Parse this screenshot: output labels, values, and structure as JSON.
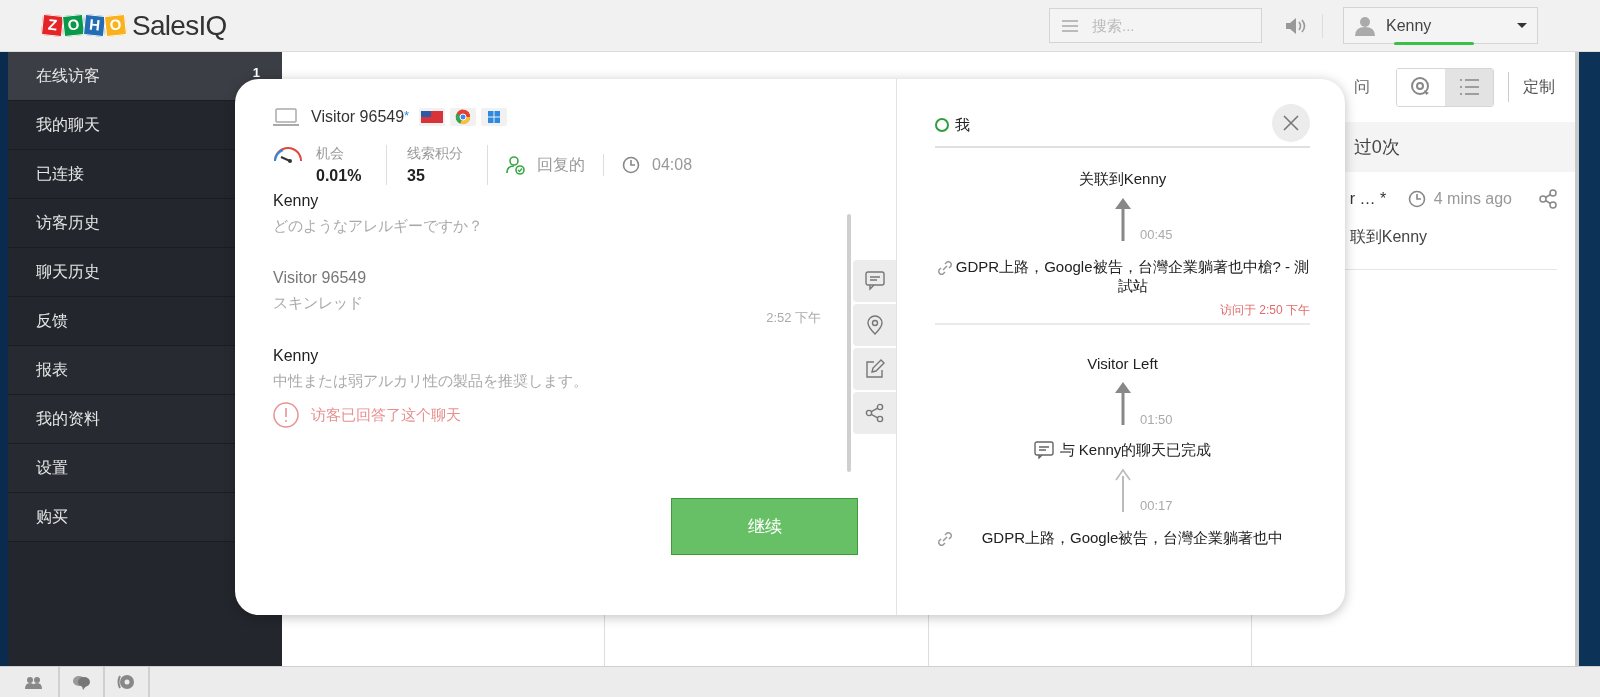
{
  "header": {
    "logo_letters": [
      {
        "letter": "Z",
        "color": "#e42527"
      },
      {
        "letter": "O",
        "color": "#089949"
      },
      {
        "letter": "H",
        "color": "#226db4"
      },
      {
        "letter": "O",
        "color": "#f9b21d"
      }
    ],
    "product": "SalesIQ",
    "search": {
      "placeholder": "搜索..."
    },
    "user": "Kenny"
  },
  "sidebar": {
    "items": [
      {
        "label": "在线访客",
        "count": "1",
        "selected": true
      },
      {
        "label": "我的聊天",
        "selected": false
      },
      {
        "label": "已连接",
        "selected": false
      },
      {
        "label": "访客历史",
        "selected": false
      },
      {
        "label": "聊天历史",
        "selected": false
      },
      {
        "label": "反馈",
        "selected": false
      },
      {
        "label": "报表",
        "selected": false
      },
      {
        "label": "我的资料",
        "selected": false
      },
      {
        "label": "设置",
        "selected": false
      },
      {
        "label": "购买",
        "selected": false
      }
    ]
  },
  "background": {
    "toolbar_fragment": "问",
    "view_buttons": [
      {
        "kind": "ring",
        "selected": false
      },
      {
        "kind": "list",
        "selected": true
      }
    ],
    "customize": "定制",
    "row_fragment": "过0次",
    "card": {
      "name_fragment": "r … *",
      "time": "4 mins ago",
      "text_fragment": "联到Kenny"
    }
  },
  "modal": {
    "visitor": {
      "name": "Visitor 96549",
      "asterisk": "*"
    },
    "stats": {
      "chance_label": "机会",
      "chance_value": "0.01%",
      "score_label": "线索积分",
      "score_value": "35",
      "status": "回复的",
      "duration": "04:08"
    },
    "messages": [
      {
        "kind": "agent",
        "sender": "Kenny",
        "text": "どのようなアレルギーですか？"
      },
      {
        "kind": "visitor",
        "sender": "Visitor 96549",
        "text": "スキンレッド",
        "time": "2:52 下午"
      },
      {
        "kind": "agent",
        "sender": "Kenny",
        "text": "中性または弱アルカリ性の製品を推奨します。"
      },
      {
        "kind": "notice",
        "text": "访客已回答了这个聊天"
      }
    ],
    "side_buttons": [
      {
        "kind": "chat"
      },
      {
        "kind": "location"
      },
      {
        "kind": "edit"
      },
      {
        "kind": "share"
      }
    ],
    "continue_button": "继续",
    "owner": "我",
    "timeline": [
      {
        "kind": "event",
        "text": "关联到Kenny"
      },
      {
        "kind": "arrow",
        "time": "00:45"
      },
      {
        "kind": "page",
        "title": "GDPR上路，Google被告，台灣企業躺著也中槍? - 測試站",
        "visited": "访问于 2:50 下午"
      },
      {
        "kind": "event",
        "text": "Visitor Left"
      },
      {
        "kind": "arrow",
        "time": "01:50"
      },
      {
        "kind": "chat",
        "text": "与 Kenny的聊天已完成"
      },
      {
        "kind": "faint_arrow",
        "time": "00:17"
      },
      {
        "kind": "page",
        "title": "GDPR上路，Google被告，台灣企業躺著也中"
      }
    ]
  },
  "bottom_tabs": [
    {
      "kind": "people"
    },
    {
      "kind": "chats"
    },
    {
      "kind": "disc"
    }
  ]
}
